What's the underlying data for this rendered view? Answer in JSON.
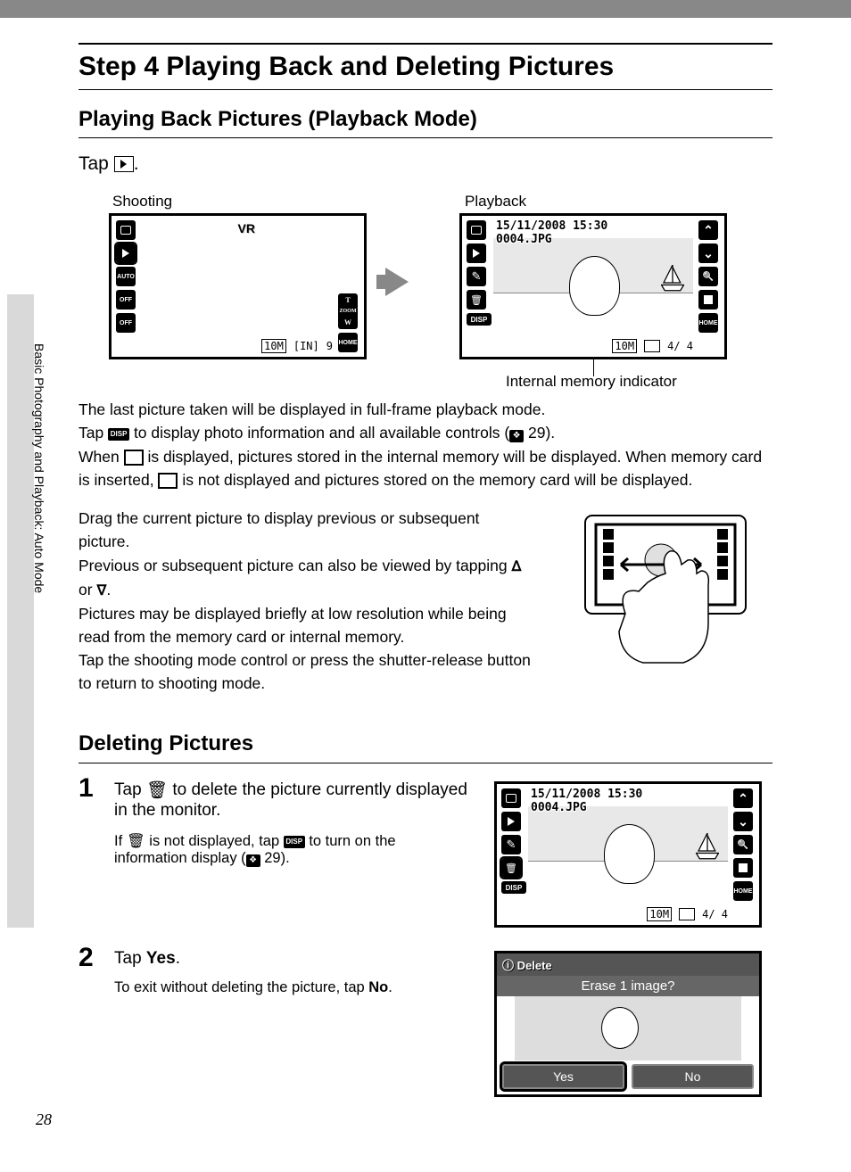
{
  "title": "Step 4 Playing Back and Deleting Pictures",
  "section1": "Playing Back Pictures (Playback Mode)",
  "tap_prefix": "Tap ",
  "tap_suffix": ".",
  "labels": {
    "shooting": "Shooting",
    "playback": "Playback",
    "internal_mem": "Internal memory indicator"
  },
  "screen": {
    "auto": "AUTO",
    "off1": "OFF",
    "off2": "OFF",
    "vr": "VR",
    "tzoom_t": "T",
    "tzoom_z": "ZOOM",
    "tzoom_w": "W",
    "home": "HOME",
    "mode": "10M",
    "mem": "[IN]",
    "count": "9",
    "date": "15/11/2008 15:30",
    "file": "0004.JPG",
    "counter": "4/   4",
    "disp": "DISP"
  },
  "para1a": "The last picture taken will be displayed in full-frame playback mode.",
  "para1b_a": "Tap ",
  "para1b_b": " to display photo information and all available controls (",
  "para1b_c": " 29).",
  "para1c_a": "When ",
  "para1c_b": " is displayed, pictures stored in the internal memory will be displayed. When memory card is inserted, ",
  "para1c_c": " is not displayed and pictures stored on the memory card will be displayed.",
  "para2a": "Drag the current picture to display previous or subsequent picture.",
  "para2b_a": "Previous or subsequent picture can also be viewed by tapping ",
  "para2b_or": " or ",
  "para2b_end": ".",
  "para2c": "Pictures may be displayed briefly at low resolution while being read from the memory card or internal memory.",
  "para2d": "Tap the shooting mode control or press the shutter-release button to return to shooting mode.",
  "section2": "Deleting Pictures",
  "step1_a": "Tap ",
  "step1_b": " to delete the picture currently displayed in the monitor.",
  "step1body_a": "If ",
  "step1body_b": " is not displayed, tap ",
  "step1body_c": " to turn on the information display (",
  "step1body_d": " 29).",
  "step2": "Tap ",
  "step2_yes": "Yes",
  "step2_end": ".",
  "step2body_a": "To exit without deleting the picture, tap ",
  "step2body_no": "No",
  "step2body_end": ".",
  "dialog": {
    "title": "Delete",
    "q": "Erase 1 image?",
    "yes": "Yes",
    "no": "No"
  },
  "sidebar": "Basic Photography and Playback: Auto Mode",
  "pagenum": "28",
  "num1": "1",
  "num2": "2",
  "chev_up": "ᐃ",
  "chev_down": "ᐁ"
}
